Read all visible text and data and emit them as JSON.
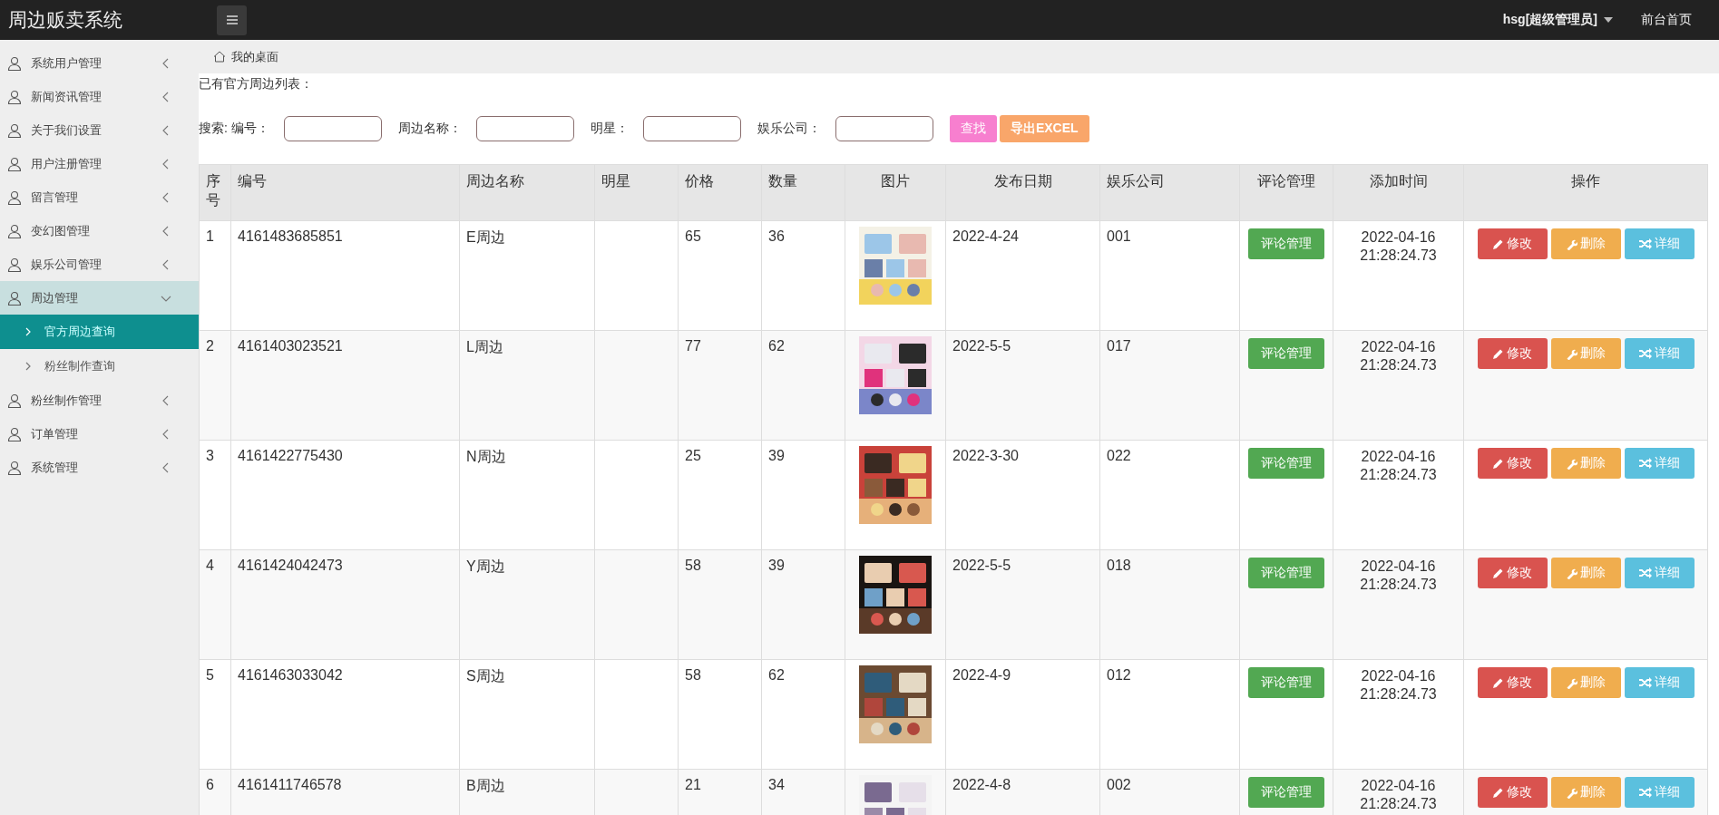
{
  "header": {
    "title": "周边贩卖系统",
    "user": "hsg[超级管理员]",
    "front_link": "前台首页"
  },
  "sidebar": {
    "items": [
      {
        "label": "系统用户管理",
        "expanded": false
      },
      {
        "label": "新闻资讯管理",
        "expanded": false
      },
      {
        "label": "关于我们设置",
        "expanded": false
      },
      {
        "label": "用户注册管理",
        "expanded": false
      },
      {
        "label": "留言管理",
        "expanded": false
      },
      {
        "label": "变幻图管理",
        "expanded": false
      },
      {
        "label": "娱乐公司管理",
        "expanded": false
      },
      {
        "label": "周边管理",
        "expanded": true,
        "children": [
          {
            "label": "官方周边查询",
            "selected": true
          },
          {
            "label": "粉丝制作查询",
            "selected": false
          }
        ]
      },
      {
        "label": "粉丝制作管理",
        "expanded": false
      },
      {
        "label": "订单管理",
        "expanded": false
      },
      {
        "label": "系统管理",
        "expanded": false
      }
    ]
  },
  "breadcrumb": "我的桌面",
  "list_title": "已有官方周边列表：",
  "search": {
    "label": "搜索:",
    "fields": [
      {
        "label": "编号："
      },
      {
        "label": "周边名称："
      },
      {
        "label": "明星："
      },
      {
        "label": "娱乐公司："
      }
    ],
    "buttons": [
      {
        "kind": "search",
        "label": "查找"
      },
      {
        "kind": "export",
        "label": "导出EXCEL"
      }
    ]
  },
  "table": {
    "columns": [
      "序号",
      "编号",
      "周边名称",
      "明星",
      "价格",
      "数量",
      "图片",
      "发布日期",
      "娱乐公司",
      "评论管理",
      "添加时间",
      "操作"
    ],
    "rows": [
      {
        "index": "1",
        "code": "4161483685851",
        "name": "E周边",
        "price": "65",
        "quantity": "36",
        "date": "2022-4-24",
        "company": "001",
        "comment_button": "评论管理",
        "added": "2022-04-16 21:28:24.73",
        "actions": [
          {
            "kind": "edit",
            "label": "修改"
          },
          {
            "kind": "delete",
            "label": "删除"
          },
          {
            "kind": "detail",
            "label": "详细"
          }
        ]
      },
      {
        "index": "2",
        "code": "4161403023521",
        "name": "L周边",
        "price": "77",
        "quantity": "62",
        "date": "2022-5-5",
        "company": "017",
        "comment_button": "评论管理",
        "added": "2022-04-16 21:28:24.73",
        "actions": [
          {
            "kind": "edit",
            "label": "修改"
          },
          {
            "kind": "delete",
            "label": "删除"
          },
          {
            "kind": "detail",
            "label": "详细"
          }
        ]
      },
      {
        "index": "3",
        "code": "4161422775430",
        "name": "N周边",
        "price": "25",
        "quantity": "39",
        "date": "2022-3-30",
        "company": "022",
        "comment_button": "评论管理",
        "added": "2022-04-16 21:28:24.73",
        "actions": [
          {
            "kind": "edit",
            "label": "修改"
          },
          {
            "kind": "delete",
            "label": "删除"
          },
          {
            "kind": "detail",
            "label": "详细"
          }
        ]
      },
      {
        "index": "4",
        "code": "4161424042473",
        "name": "Y周边",
        "price": "58",
        "quantity": "39",
        "date": "2022-5-5",
        "company": "018",
        "comment_button": "评论管理",
        "added": "2022-04-16 21:28:24.73",
        "actions": [
          {
            "kind": "edit",
            "label": "修改"
          },
          {
            "kind": "delete",
            "label": "删除"
          },
          {
            "kind": "detail",
            "label": "详细"
          }
        ]
      },
      {
        "index": "5",
        "code": "4161463033042",
        "name": "S周边",
        "price": "58",
        "quantity": "62",
        "date": "2022-4-9",
        "company": "012",
        "comment_button": "评论管理",
        "added": "2022-04-16 21:28:24.73",
        "actions": [
          {
            "kind": "edit",
            "label": "修改"
          },
          {
            "kind": "delete",
            "label": "删除"
          },
          {
            "kind": "detail",
            "label": "详细"
          }
        ]
      },
      {
        "index": "6",
        "code": "4161411746578",
        "name": "B周边",
        "price": "21",
        "quantity": "34",
        "date": "2022-4-8",
        "company": "002",
        "comment_button": "评论管理",
        "added": "2022-04-16 21:28:24.73",
        "actions": [
          {
            "kind": "edit",
            "label": "修改"
          },
          {
            "kind": "delete",
            "label": "删除"
          },
          {
            "kind": "detail",
            "label": "详细"
          }
        ]
      }
    ]
  }
}
